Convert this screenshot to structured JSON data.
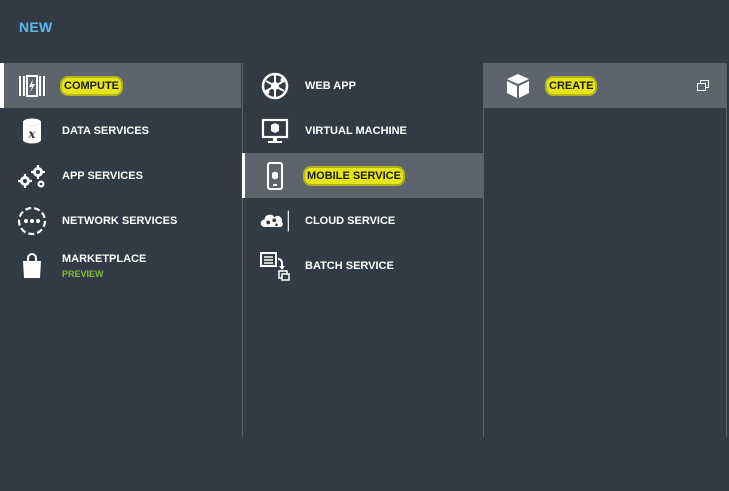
{
  "header": {
    "title": "NEW"
  },
  "categories": [
    {
      "label": "COMPUTE",
      "icon": "compute-icon",
      "selected": true
    },
    {
      "label": "DATA SERVICES",
      "icon": "database-icon",
      "selected": false
    },
    {
      "label": "APP SERVICES",
      "icon": "gears-icon",
      "selected": false
    },
    {
      "label": "NETWORK SERVICES",
      "icon": "network-icon",
      "selected": false
    },
    {
      "label": "MARKETPLACE",
      "sublabel": "PREVIEW",
      "icon": "shopping-bag-icon",
      "selected": false
    }
  ],
  "services": [
    {
      "label": "WEB APP",
      "icon": "web-app-icon",
      "selected": false
    },
    {
      "label": "VIRTUAL MACHINE",
      "icon": "virtual-machine-icon",
      "selected": false
    },
    {
      "label": "MOBILE SERVICE",
      "icon": "mobile-service-icon",
      "selected": true
    },
    {
      "label": "CLOUD SERVICE",
      "icon": "cloud-service-icon",
      "selected": false
    },
    {
      "label": "BATCH SERVICE",
      "icon": "batch-service-icon",
      "selected": false
    }
  ],
  "actions": [
    {
      "label": "CREATE",
      "icon": "cube-icon",
      "selected": true,
      "trailing_icon": "open-window-icon"
    }
  ],
  "colors": {
    "background": "#323a45",
    "selected_row": "#5d646d",
    "title_blue": "#5eb9f0",
    "highlight": "#e5e619",
    "preview_green": "#7cbf2f"
  }
}
